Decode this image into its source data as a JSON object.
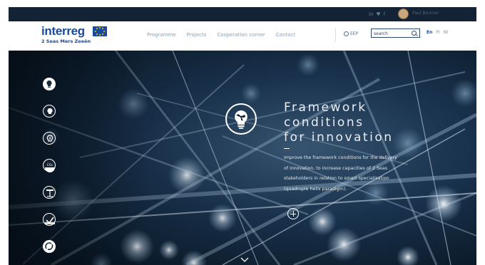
{
  "topbar": {
    "social_icons": [
      "linkedin-icon",
      "twitter-icon",
      "facebook-icon"
    ],
    "social_glyphs": [
      "in",
      "♥",
      "f"
    ],
    "user_name": "Paul Bonnier"
  },
  "logo": {
    "word": "interreg",
    "subtitle": "2 Seas Mers Zeeën"
  },
  "nav": {
    "items": [
      "Programme",
      "Projects",
      "Cooperation corner",
      "Contact"
    ],
    "eep_label": "EEP",
    "search_placeholder": "search",
    "languages": [
      "En",
      "Fr",
      "Nl"
    ],
    "active_language": "En"
  },
  "hero": {
    "title_lines": [
      "Framework",
      "conditions",
      "for innovation"
    ],
    "description_lines": [
      "Improve the framework conditions for the delivery",
      "of innovation, to increase capacities of 2 Seas",
      "stakeholders in relation to smart specialisation",
      "(quadruple helix paradigm)."
    ],
    "side_icons": [
      "innovation-bulb-icon",
      "technology-bulb-icon",
      "social-bulb-icon",
      "co2-icon",
      "climate-adaptation-icon",
      "resource-efficiency-icon",
      "circular-economy-icon"
    ],
    "side_labels": [
      "",
      "",
      "",
      "CO₂",
      "",
      "",
      ""
    ],
    "colors": {
      "accent_blue": "#1a4a9c",
      "hero_dark": "#0a1b2c",
      "text_light": "#e8eef4"
    }
  }
}
